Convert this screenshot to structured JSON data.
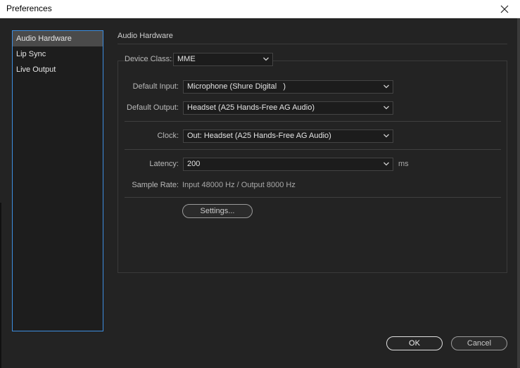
{
  "window": {
    "title": "Preferences"
  },
  "sidebar": {
    "items": [
      {
        "label": "Audio Hardware",
        "selected": true
      },
      {
        "label": "Lip Sync",
        "selected": false
      },
      {
        "label": "Live Output",
        "selected": false
      }
    ]
  },
  "section": {
    "title": "Audio Hardware"
  },
  "device_class": {
    "label": "Device Class:",
    "value": "MME"
  },
  "default_input": {
    "label": "Default Input:",
    "value": "Microphone (Shure Digital   )"
  },
  "default_output": {
    "label": "Default Output:",
    "value": "Headset (A25 Hands-Free AG Audio)"
  },
  "clock": {
    "label": "Clock:",
    "value": "Out: Headset (A25 Hands-Free AG Audio)"
  },
  "latency": {
    "label": "Latency:",
    "value": "200",
    "unit": "ms"
  },
  "sample_rate": {
    "label": "Sample Rate:",
    "value": "Input 48000 Hz / Output 8000 Hz"
  },
  "buttons": {
    "settings": "Settings...",
    "ok": "OK",
    "cancel": "Cancel"
  },
  "colors": {
    "background": "#232323",
    "accent": "#3d8ee0"
  },
  "icons": {
    "close": "close-icon",
    "dropdown": "chevron-down-icon"
  }
}
